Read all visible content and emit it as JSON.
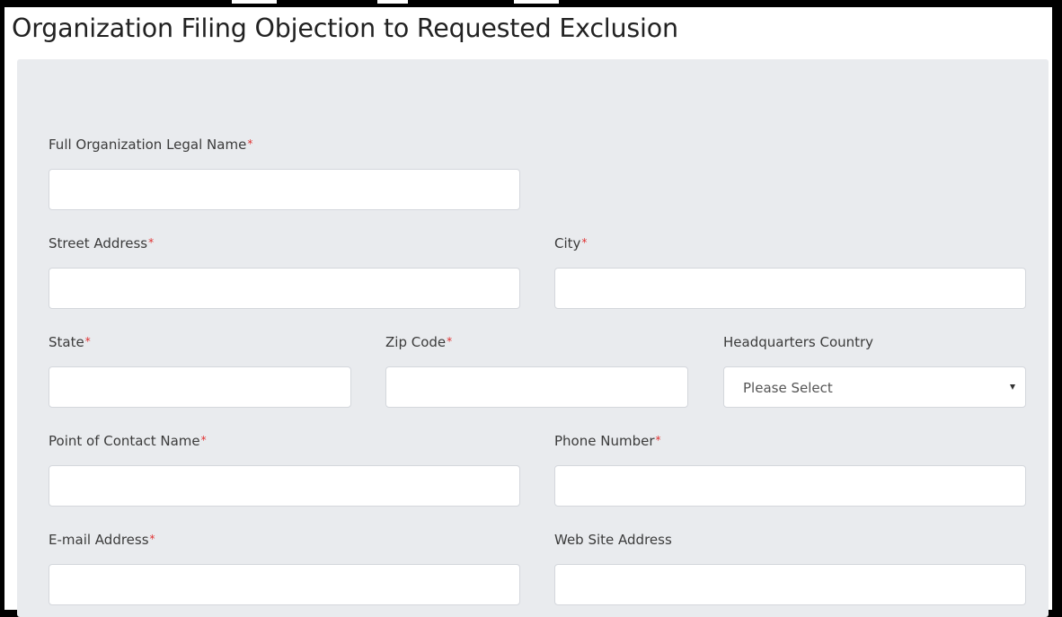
{
  "page": {
    "title": "Organization Filing Objection to Requested Exclusion"
  },
  "form": {
    "fields": {
      "org_name": {
        "label": "Full Organization Legal Name",
        "required_mark": "*",
        "value": ""
      },
      "street": {
        "label": "Street Address",
        "required_mark": "*",
        "value": ""
      },
      "city": {
        "label": "City",
        "required_mark": "*",
        "value": ""
      },
      "state": {
        "label": "State",
        "required_mark": "*",
        "value": ""
      },
      "zip": {
        "label": "Zip Code",
        "required_mark": "*",
        "value": ""
      },
      "country": {
        "label": "Headquarters Country",
        "selected": "Please Select"
      },
      "contact_name": {
        "label": "Point of Contact Name",
        "required_mark": "*",
        "value": ""
      },
      "phone": {
        "label": "Phone Number",
        "required_mark": "*",
        "value": ""
      },
      "email": {
        "label": "E-mail Address",
        "required_mark": "*",
        "value": ""
      },
      "website": {
        "label": "Web Site Address",
        "value": ""
      }
    }
  },
  "colors": {
    "panel_bg": "#e9ebee",
    "required": "#e03030",
    "frame": "#000000"
  },
  "icons": {
    "dropdown": "chevron-down-icon"
  }
}
